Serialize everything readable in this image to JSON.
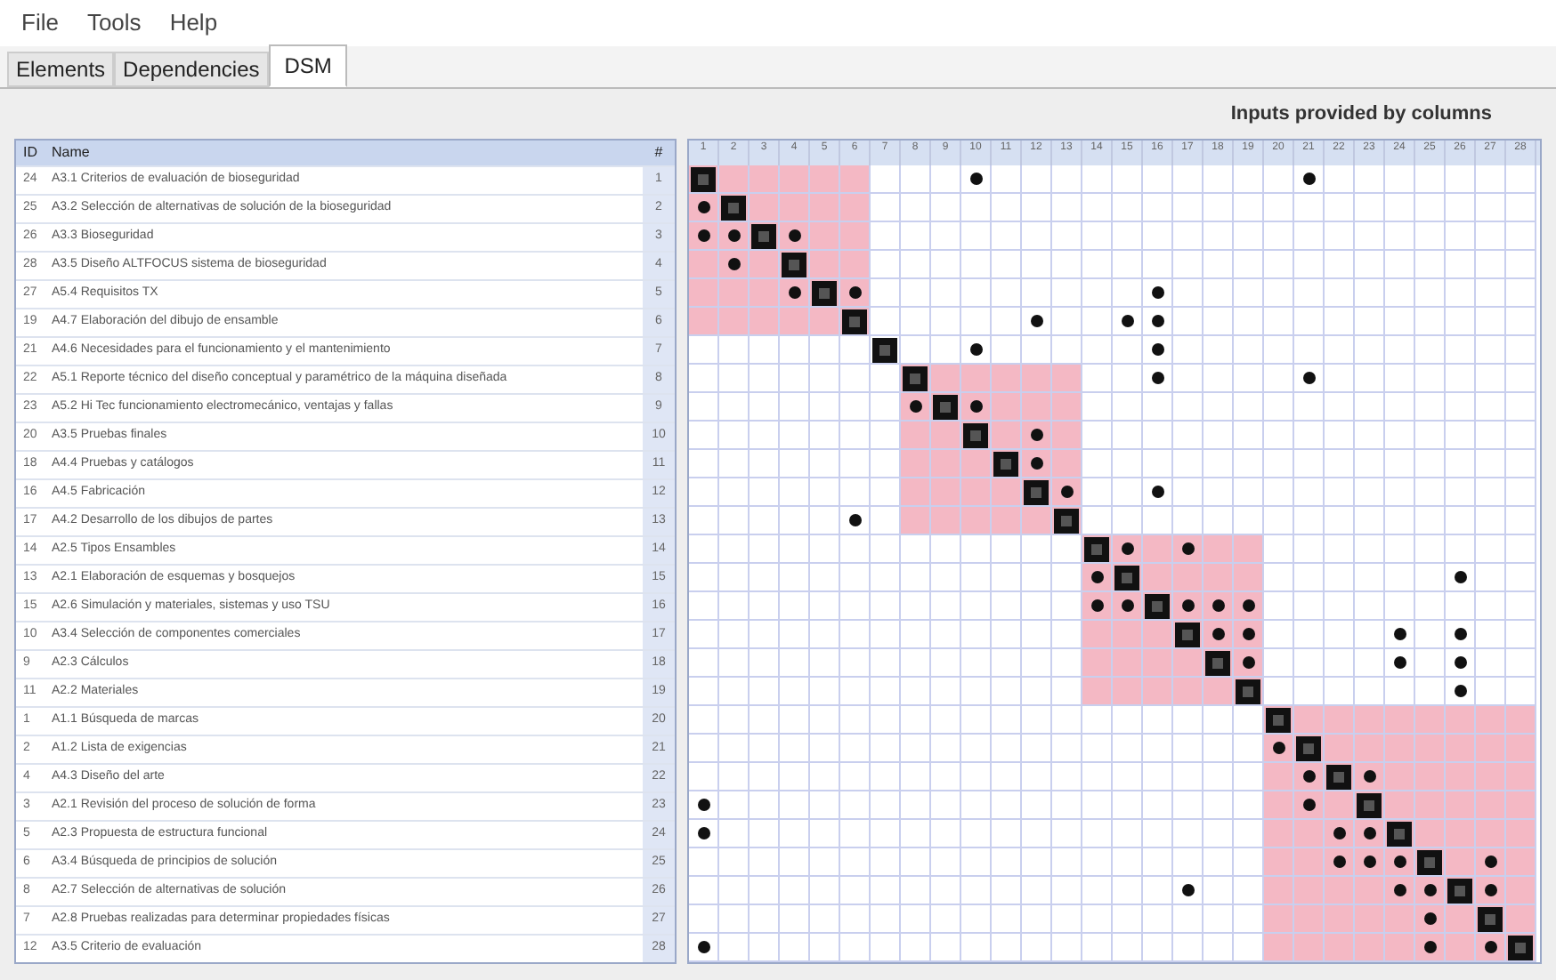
{
  "menu": [
    "File",
    "Tools",
    "Help"
  ],
  "tabs": [
    {
      "label": "Elements",
      "selected": false
    },
    {
      "label": "Dependencies",
      "selected": false
    },
    {
      "label": "DSM",
      "selected": true
    }
  ],
  "matrix_caption": "Inputs provided by columns",
  "table": {
    "columns": [
      "ID",
      "Name",
      "#"
    ],
    "groups": [
      {
        "highlighted": true,
        "rows": [
          {
            "id": "24",
            "name": "A3.1 Criterios de evaluación de bioseguridad",
            "index": "1",
            "links": [
              false,
              false,
              false,
              false,
              false,
              false,
              false,
              false,
              false,
              true,
              false,
              false,
              false,
              false,
              false,
              false,
              false,
              false,
              false,
              false,
              true,
              false,
              false,
              false,
              false,
              false,
              false,
              false
            ]
          },
          {
            "id": "25",
            "name": "A3.2 Selección de alternativas de solución de la bioseguridad",
            "index": "2",
            "links": [
              true,
              false,
              false,
              false,
              false,
              false,
              false,
              false,
              false,
              false,
              false,
              false,
              false,
              false,
              false,
              false,
              false,
              false,
              false,
              false,
              false,
              false,
              false,
              false,
              false,
              false,
              false,
              false
            ]
          },
          {
            "id": "26",
            "name": "A3.3 Bioseguridad",
            "index": "3",
            "links": [
              true,
              true,
              false,
              true,
              false,
              false,
              false,
              false,
              false,
              false,
              false,
              false,
              false,
              false,
              false,
              false,
              false,
              false,
              false,
              false,
              false,
              false,
              false,
              false,
              false,
              false,
              false,
              false
            ]
          },
          {
            "id": "28",
            "name": "A3.5 Diseño ALTFOCUS sistema de bioseguridad",
            "index": "4",
            "links": [
              false,
              true,
              false,
              false,
              false,
              false,
              false,
              false,
              false,
              false,
              false,
              false,
              false,
              false,
              false,
              false,
              false,
              false,
              false,
              false,
              false,
              false,
              false,
              false,
              false,
              false,
              false,
              false
            ]
          },
          {
            "id": "27",
            "name": "A5.4 Requisitos TX",
            "index": "5",
            "links": [
              false,
              false,
              false,
              true,
              false,
              true,
              false,
              false,
              false,
              false,
              false,
              false,
              false,
              false,
              false,
              true,
              false,
              false,
              false,
              false,
              false,
              false,
              false,
              false,
              false,
              false,
              false,
              false
            ]
          },
          {
            "id": "19",
            "name": "A4.7 Elaboración del dibujo de ensamble",
            "index": "6",
            "links": [
              false,
              false,
              false,
              false,
              false,
              false,
              false,
              false,
              false,
              false,
              false,
              true,
              false,
              false,
              true,
              true,
              false,
              false,
              false,
              false,
              false,
              false,
              false,
              false,
              false,
              false,
              false,
              false
            ]
          }
        ]
      },
      {
        "highlighted": false,
        "rows": [
          {
            "id": "21",
            "name": "A4.6 Necesidades para el funcionamiento y el mantenimiento",
            "index": "7",
            "links": [
              false,
              false,
              false,
              false,
              false,
              false,
              false,
              false,
              false,
              true,
              false,
              false,
              false,
              false,
              false,
              true,
              false,
              false,
              false,
              false,
              false,
              false,
              false,
              false,
              false,
              false,
              false,
              false
            ]
          }
        ]
      },
      {
        "highlighted": true,
        "rows": [
          {
            "id": "22",
            "name": "A5.1 Reporte técnico del diseño conceptual y paramétrico de la máquina diseñada",
            "index": "8",
            "links": [
              false,
              false,
              false,
              false,
              false,
              false,
              false,
              false,
              false,
              false,
              false,
              false,
              false,
              false,
              false,
              true,
              false,
              false,
              false,
              false,
              true,
              false,
              false,
              false,
              false,
              false,
              false,
              false
            ]
          },
          {
            "id": "23",
            "name": "A5.2 Hi Tec funcionamiento electromecánico, ventajas y fallas",
            "index": "9",
            "links": [
              false,
              false,
              false,
              false,
              false,
              false,
              false,
              true,
              false,
              true,
              false,
              false,
              false,
              false,
              false,
              false,
              false,
              false,
              false,
              false,
              false,
              false,
              false,
              false,
              false,
              false,
              false,
              false
            ]
          },
          {
            "id": "20",
            "name": "A3.5 Pruebas finales",
            "index": "10",
            "links": [
              false,
              false,
              false,
              false,
              false,
              false,
              false,
              false,
              false,
              false,
              false,
              true,
              false,
              false,
              false,
              false,
              false,
              false,
              false,
              false,
              false,
              false,
              false,
              false,
              false,
              false,
              false,
              false
            ]
          },
          {
            "id": "18",
            "name": "A4.4 Pruebas y catálogos",
            "index": "11",
            "links": [
              false,
              false,
              false,
              false,
              false,
              false,
              false,
              false,
              false,
              false,
              false,
              true,
              false,
              false,
              false,
              false,
              false,
              false,
              false,
              false,
              false,
              false,
              false,
              false,
              false,
              false,
              false,
              false
            ]
          },
          {
            "id": "16",
            "name": "A4.5 Fabricación",
            "index": "12",
            "links": [
              false,
              false,
              false,
              false,
              false,
              false,
              false,
              false,
              false,
              false,
              false,
              false,
              true,
              false,
              false,
              true,
              false,
              false,
              false,
              false,
              false,
              false,
              false,
              false,
              false,
              false,
              false,
              false
            ]
          },
          {
            "id": "17",
            "name": "A4.2 Desarrollo de los dibujos de partes",
            "index": "13",
            "links": [
              false,
              false,
              false,
              false,
              false,
              true,
              false,
              false,
              false,
              false,
              false,
              false,
              false,
              false,
              false,
              false,
              false,
              false,
              false,
              false,
              false,
              false,
              false,
              false,
              false,
              false,
              false,
              false
            ]
          }
        ]
      },
      {
        "highlighted": true,
        "rows": [
          {
            "id": "14",
            "name": "A2.5 Tipos Ensambles",
            "index": "14",
            "links": [
              false,
              false,
              false,
              false,
              false,
              false,
              false,
              false,
              false,
              false,
              false,
              false,
              false,
              false,
              true,
              false,
              true,
              false,
              false,
              false,
              false,
              false,
              false,
              false,
              false,
              false,
              false,
              false
            ]
          },
          {
            "id": "13",
            "name": "A2.1 Elaboración de esquemas y bosquejos",
            "index": "15",
            "links": [
              false,
              false,
              false,
              false,
              false,
              false,
              false,
              false,
              false,
              false,
              false,
              false,
              false,
              true,
              false,
              false,
              false,
              false,
              false,
              false,
              false,
              false,
              false,
              false,
              false,
              true,
              false,
              false
            ]
          },
          {
            "id": "15",
            "name": "A2.6 Simulación y materiales, sistemas y uso TSU",
            "index": "16",
            "links": [
              false,
              false,
              false,
              false,
              false,
              false,
              false,
              false,
              false,
              false,
              false,
              false,
              false,
              true,
              true,
              false,
              true,
              true,
              true,
              false,
              false,
              false,
              false,
              false,
              false,
              false,
              false,
              false
            ]
          },
          {
            "id": "10",
            "name": "A3.4 Selección de componentes comerciales",
            "index": "17",
            "links": [
              false,
              false,
              false,
              false,
              false,
              false,
              false,
              false,
              false,
              false,
              false,
              false,
              false,
              false,
              false,
              false,
              false,
              true,
              true,
              false,
              false,
              false,
              false,
              true,
              false,
              true,
              false,
              false
            ]
          },
          {
            "id": "9",
            "name": "A2.3 Cálculos",
            "index": "18",
            "links": [
              false,
              false,
              false,
              false,
              false,
              false,
              false,
              false,
              false,
              false,
              false,
              false,
              false,
              false,
              false,
              false,
              false,
              false,
              true,
              false,
              false,
              false,
              false,
              true,
              false,
              true,
              false,
              false
            ]
          },
          {
            "id": "11",
            "name": "A2.2 Materiales",
            "index": "19",
            "links": [
              false,
              false,
              false,
              false,
              false,
              false,
              false,
              false,
              false,
              false,
              false,
              false,
              false,
              false,
              false,
              false,
              false,
              false,
              false,
              false,
              false,
              false,
              false,
              false,
              false,
              true,
              false,
              false
            ]
          }
        ]
      },
      {
        "highlighted": true,
        "rows": [
          {
            "id": "1",
            "name": "A1.1 Búsqueda de marcas",
            "index": "20",
            "links": [
              false,
              false,
              false,
              false,
              false,
              false,
              false,
              false,
              false,
              false,
              false,
              false,
              false,
              false,
              false,
              false,
              false,
              false,
              false,
              false,
              false,
              false,
              false,
              false,
              false,
              false,
              false,
              false
            ]
          },
          {
            "id": "2",
            "name": "A1.2 Lista de exigencias",
            "index": "21",
            "links": [
              false,
              false,
              false,
              false,
              false,
              false,
              false,
              false,
              false,
              false,
              false,
              false,
              false,
              false,
              false,
              false,
              false,
              false,
              false,
              true,
              false,
              false,
              false,
              false,
              false,
              false,
              false,
              false
            ]
          },
          {
            "id": "4",
            "name": "A4.3 Diseño del arte",
            "index": "22",
            "links": [
              false,
              false,
              false,
              false,
              false,
              false,
              false,
              false,
              false,
              false,
              false,
              false,
              false,
              false,
              false,
              false,
              false,
              false,
              false,
              false,
              true,
              false,
              true,
              false,
              false,
              false,
              false,
              false
            ]
          },
          {
            "id": "3",
            "name": "A2.1 Revisión del proceso de solución de forma",
            "index": "23",
            "links": [
              true,
              false,
              false,
              false,
              false,
              false,
              false,
              false,
              false,
              false,
              false,
              false,
              false,
              false,
              false,
              false,
              false,
              false,
              false,
              false,
              true,
              false,
              false,
              false,
              false,
              false,
              false,
              false
            ]
          },
          {
            "id": "5",
            "name": "A2.3 Propuesta de estructura funcional",
            "index": "24",
            "links": [
              true,
              false,
              false,
              false,
              false,
              false,
              false,
              false,
              false,
              false,
              false,
              false,
              false,
              false,
              false,
              false,
              false,
              false,
              false,
              false,
              false,
              true,
              true,
              false,
              false,
              false,
              false,
              false
            ]
          },
          {
            "id": "6",
            "name": "A3.4 Búsqueda de principios de solución",
            "index": "25",
            "links": [
              false,
              false,
              false,
              false,
              false,
              false,
              false,
              false,
              false,
              false,
              false,
              false,
              false,
              false,
              false,
              false,
              false,
              false,
              false,
              false,
              false,
              true,
              true,
              true,
              false,
              false,
              true,
              false
            ]
          },
          {
            "id": "8",
            "name": "A2.7 Selección de alternativas de solución",
            "index": "26",
            "links": [
              false,
              false,
              false,
              false,
              false,
              false,
              false,
              false,
              false,
              false,
              false,
              false,
              false,
              false,
              false,
              false,
              true,
              false,
              false,
              false,
              false,
              false,
              false,
              true,
              true,
              false,
              true,
              false
            ]
          },
          {
            "id": "7",
            "name": "A2.8 Pruebas realizadas para determinar propiedades físicas",
            "index": "27",
            "links": [
              false,
              false,
              false,
              false,
              false,
              false,
              false,
              false,
              false,
              false,
              false,
              false,
              false,
              false,
              false,
              false,
              false,
              false,
              false,
              false,
              false,
              false,
              false,
              false,
              true,
              false,
              false,
              false
            ]
          },
          {
            "id": "12",
            "name": "A3.5 Criterio de evaluación",
            "index": "28",
            "links": [
              true,
              false,
              false,
              false,
              false,
              false,
              false,
              false,
              false,
              false,
              false,
              false,
              false,
              false,
              false,
              false,
              false,
              false,
              false,
              false,
              false,
              false,
              false,
              false,
              true,
              false,
              true,
              false
            ]
          }
        ]
      }
    ]
  },
  "matrix": {
    "columns": [
      "1",
      "2",
      "3",
      "4",
      "5",
      "6",
      "7",
      "8",
      "9",
      "10",
      "11",
      "12",
      "13",
      "14",
      "15",
      "16",
      "17",
      "18",
      "19",
      "20",
      "21",
      "22",
      "23",
      "24",
      "25",
      "26",
      "27",
      "28"
    ]
  }
}
